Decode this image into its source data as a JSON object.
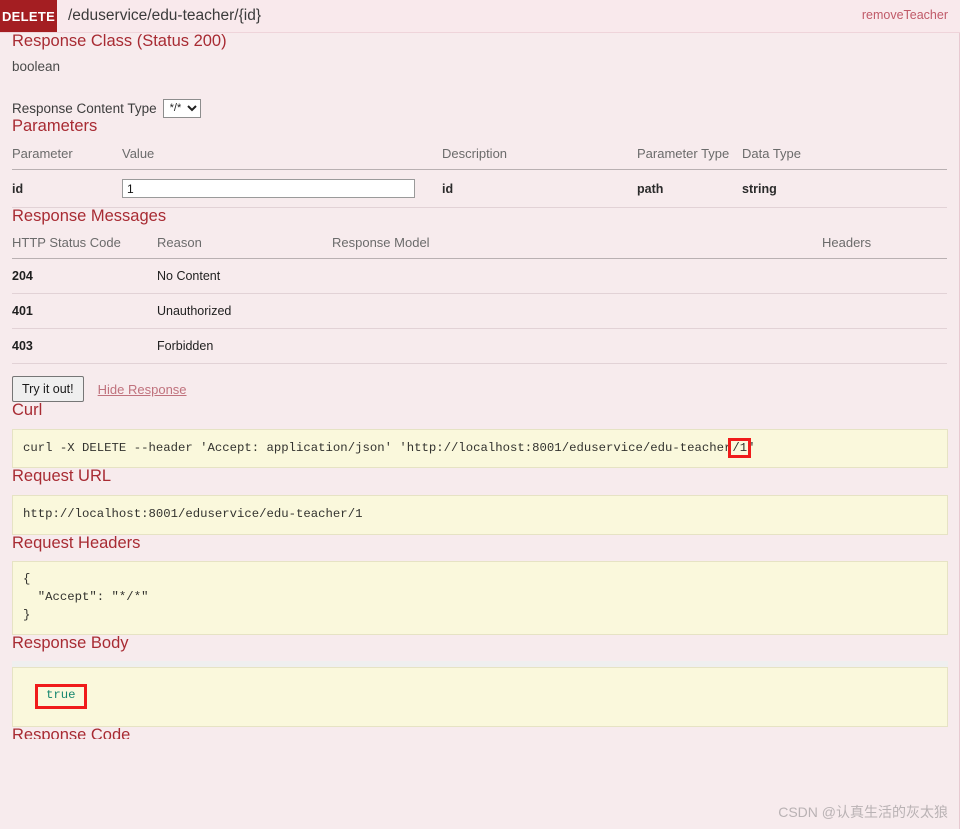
{
  "operation": {
    "method": "DELETE",
    "path": "/eduservice/edu-teacher/{id}",
    "nickname": "removeTeacher"
  },
  "response_class": {
    "title": "Response Class (Status 200)",
    "type": "boolean"
  },
  "content_type": {
    "label": "Response Content Type",
    "selected": "*/*",
    "options": [
      "*/*"
    ]
  },
  "parameters": {
    "title": "Parameters",
    "headers": [
      "Parameter",
      "Value",
      "Description",
      "Parameter Type",
      "Data Type"
    ],
    "rows": [
      {
        "parameter": "id",
        "value": "1",
        "value_placeholder": "",
        "description": "id",
        "parameter_type": "path",
        "data_type": "string"
      }
    ]
  },
  "response_messages": {
    "title": "Response Messages",
    "headers": [
      "HTTP Status Code",
      "Reason",
      "Response Model",
      "Headers"
    ],
    "rows": [
      {
        "code": "204",
        "reason": "No Content",
        "model": "",
        "headers": ""
      },
      {
        "code": "401",
        "reason": "Unauthorized",
        "model": "",
        "headers": ""
      },
      {
        "code": "403",
        "reason": "Forbidden",
        "model": "",
        "headers": ""
      }
    ]
  },
  "actions": {
    "try_label": "Try it out!",
    "hide_response_label": "Hide Response"
  },
  "curl": {
    "title": "Curl",
    "prefix": "curl -X DELETE --header 'Accept: application/json' 'http://localhost:8001/eduservice/edu-teacher",
    "highlight": "/1",
    "suffix": "'"
  },
  "request_url": {
    "title": "Request URL",
    "value": "http://localhost:8001/eduservice/edu-teacher/1"
  },
  "request_headers": {
    "title": "Request Headers",
    "value": "{\n  \"Accept\": \"*/*\"\n}"
  },
  "response_body": {
    "title": "Response Body",
    "value": "true"
  },
  "response_code": {
    "title": "Response Code"
  },
  "watermark": {
    "text": "CSDN @认真生活的灰太狼"
  },
  "colors": {
    "method_badge": "#a41e22",
    "header_bg": "#f9e9ec",
    "page_bg": "#f7ebed",
    "section_title": "#a82b33",
    "code_bg": "#faf8dc",
    "highlight": "#f01b1b",
    "true_value": "#15866e"
  }
}
